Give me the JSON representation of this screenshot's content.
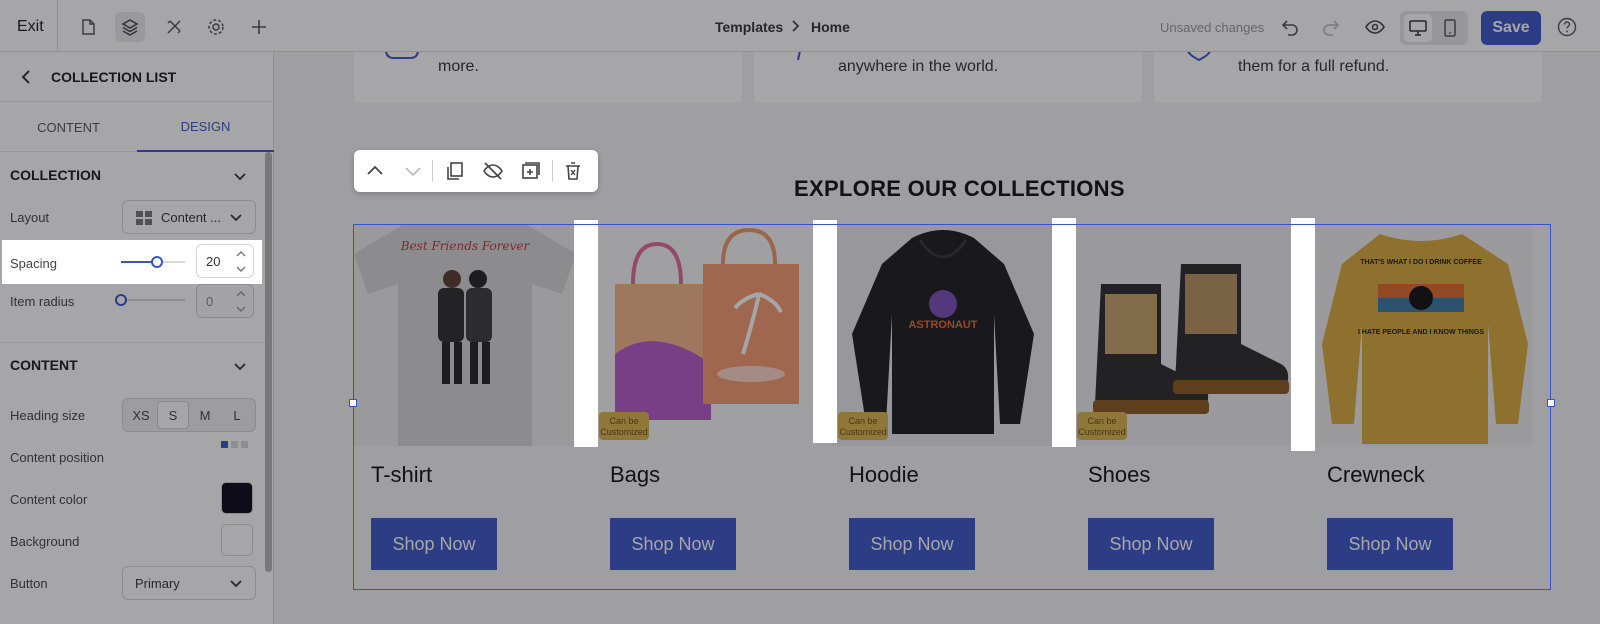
{
  "topbar": {
    "exit_label": "Exit",
    "breadcrumb": [
      "Templates",
      "Home"
    ],
    "unsaved_label": "Unsaved changes",
    "save_label": "Save"
  },
  "sidebar": {
    "title": "COLLECTION LIST",
    "tabs": [
      "CONTENT",
      "DESIGN"
    ],
    "active_tab": "DESIGN",
    "collection_section": {
      "heading": "COLLECTION",
      "layout_label": "Layout",
      "layout_value": "Content ...",
      "spacing_label": "Spacing",
      "spacing_value": "20",
      "item_radius_label": "Item radius",
      "item_radius_value": "0"
    },
    "content_section": {
      "heading": "CONTENT",
      "heading_size_label": "Heading size",
      "heading_size_options": [
        "XS",
        "S",
        "M",
        "L"
      ],
      "heading_size_selected": "S",
      "content_position_label": "Content position",
      "content_color_label": "Content color",
      "content_color": "#0a0718",
      "background_label": "Background",
      "button_label": "Button",
      "button_value": "Primary"
    }
  },
  "canvas": {
    "features": [
      {
        "text": "more."
      },
      {
        "text": "anywhere in the world."
      },
      {
        "text": "them for a full refund."
      }
    ],
    "section_title": "EXPLORE OUR COLLECTIONS",
    "collections": [
      {
        "title": "T-shirt",
        "button": "Shop Now"
      },
      {
        "title": "Bags",
        "button": "Shop Now"
      },
      {
        "title": "Hoodie",
        "button": "Shop Now"
      },
      {
        "title": "Shoes",
        "button": "Shop Now"
      },
      {
        "title": "Crewneck",
        "button": "Shop Now"
      }
    ],
    "badge_text": "Can be Customized",
    "tshirt_print": "Best Friends Forever",
    "hoodie_print": "ASTRONAUT",
    "crewneck_print_top": "THAT'S WHAT I DO I DRINK COFFEE",
    "crewneck_print_bottom": "I HATE PEOPLE AND I KNOW THINGS"
  },
  "colors": {
    "accent": "#3a54c6",
    "overlay": "rgba(20,20,30,0.38)"
  }
}
